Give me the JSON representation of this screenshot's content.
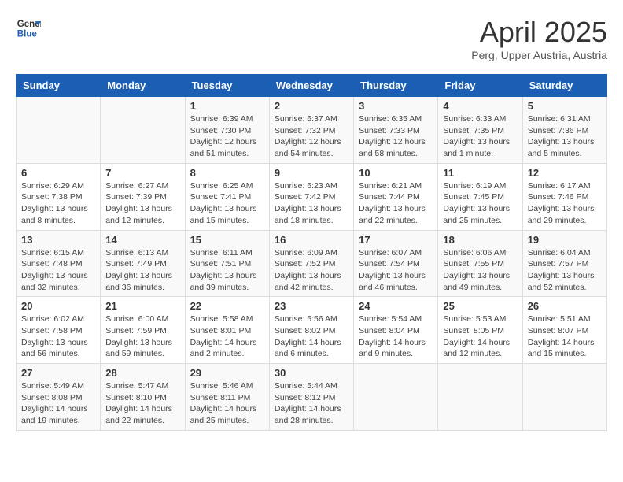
{
  "logo": {
    "line1": "General",
    "line2": "Blue"
  },
  "title": "April 2025",
  "subtitle": "Perg, Upper Austria, Austria",
  "weekdays": [
    "Sunday",
    "Monday",
    "Tuesday",
    "Wednesday",
    "Thursday",
    "Friday",
    "Saturday"
  ],
  "weeks": [
    [
      null,
      null,
      {
        "day": 1,
        "sunrise": "6:39 AM",
        "sunset": "7:30 PM",
        "daylight": "12 hours and 51 minutes."
      },
      {
        "day": 2,
        "sunrise": "6:37 AM",
        "sunset": "7:32 PM",
        "daylight": "12 hours and 54 minutes."
      },
      {
        "day": 3,
        "sunrise": "6:35 AM",
        "sunset": "7:33 PM",
        "daylight": "12 hours and 58 minutes."
      },
      {
        "day": 4,
        "sunrise": "6:33 AM",
        "sunset": "7:35 PM",
        "daylight": "13 hours and 1 minute."
      },
      {
        "day": 5,
        "sunrise": "6:31 AM",
        "sunset": "7:36 PM",
        "daylight": "13 hours and 5 minutes."
      }
    ],
    [
      {
        "day": 6,
        "sunrise": "6:29 AM",
        "sunset": "7:38 PM",
        "daylight": "13 hours and 8 minutes."
      },
      {
        "day": 7,
        "sunrise": "6:27 AM",
        "sunset": "7:39 PM",
        "daylight": "13 hours and 12 minutes."
      },
      {
        "day": 8,
        "sunrise": "6:25 AM",
        "sunset": "7:41 PM",
        "daylight": "13 hours and 15 minutes."
      },
      {
        "day": 9,
        "sunrise": "6:23 AM",
        "sunset": "7:42 PM",
        "daylight": "13 hours and 18 minutes."
      },
      {
        "day": 10,
        "sunrise": "6:21 AM",
        "sunset": "7:44 PM",
        "daylight": "13 hours and 22 minutes."
      },
      {
        "day": 11,
        "sunrise": "6:19 AM",
        "sunset": "7:45 PM",
        "daylight": "13 hours and 25 minutes."
      },
      {
        "day": 12,
        "sunrise": "6:17 AM",
        "sunset": "7:46 PM",
        "daylight": "13 hours and 29 minutes."
      }
    ],
    [
      {
        "day": 13,
        "sunrise": "6:15 AM",
        "sunset": "7:48 PM",
        "daylight": "13 hours and 32 minutes."
      },
      {
        "day": 14,
        "sunrise": "6:13 AM",
        "sunset": "7:49 PM",
        "daylight": "13 hours and 36 minutes."
      },
      {
        "day": 15,
        "sunrise": "6:11 AM",
        "sunset": "7:51 PM",
        "daylight": "13 hours and 39 minutes."
      },
      {
        "day": 16,
        "sunrise": "6:09 AM",
        "sunset": "7:52 PM",
        "daylight": "13 hours and 42 minutes."
      },
      {
        "day": 17,
        "sunrise": "6:07 AM",
        "sunset": "7:54 PM",
        "daylight": "13 hours and 46 minutes."
      },
      {
        "day": 18,
        "sunrise": "6:06 AM",
        "sunset": "7:55 PM",
        "daylight": "13 hours and 49 minutes."
      },
      {
        "day": 19,
        "sunrise": "6:04 AM",
        "sunset": "7:57 PM",
        "daylight": "13 hours and 52 minutes."
      }
    ],
    [
      {
        "day": 20,
        "sunrise": "6:02 AM",
        "sunset": "7:58 PM",
        "daylight": "13 hours and 56 minutes."
      },
      {
        "day": 21,
        "sunrise": "6:00 AM",
        "sunset": "7:59 PM",
        "daylight": "13 hours and 59 minutes."
      },
      {
        "day": 22,
        "sunrise": "5:58 AM",
        "sunset": "8:01 PM",
        "daylight": "14 hours and 2 minutes."
      },
      {
        "day": 23,
        "sunrise": "5:56 AM",
        "sunset": "8:02 PM",
        "daylight": "14 hours and 6 minutes."
      },
      {
        "day": 24,
        "sunrise": "5:54 AM",
        "sunset": "8:04 PM",
        "daylight": "14 hours and 9 minutes."
      },
      {
        "day": 25,
        "sunrise": "5:53 AM",
        "sunset": "8:05 PM",
        "daylight": "14 hours and 12 minutes."
      },
      {
        "day": 26,
        "sunrise": "5:51 AM",
        "sunset": "8:07 PM",
        "daylight": "14 hours and 15 minutes."
      }
    ],
    [
      {
        "day": 27,
        "sunrise": "5:49 AM",
        "sunset": "8:08 PM",
        "daylight": "14 hours and 19 minutes."
      },
      {
        "day": 28,
        "sunrise": "5:47 AM",
        "sunset": "8:10 PM",
        "daylight": "14 hours and 22 minutes."
      },
      {
        "day": 29,
        "sunrise": "5:46 AM",
        "sunset": "8:11 PM",
        "daylight": "14 hours and 25 minutes."
      },
      {
        "day": 30,
        "sunrise": "5:44 AM",
        "sunset": "8:12 PM",
        "daylight": "14 hours and 28 minutes."
      },
      null,
      null,
      null
    ]
  ]
}
